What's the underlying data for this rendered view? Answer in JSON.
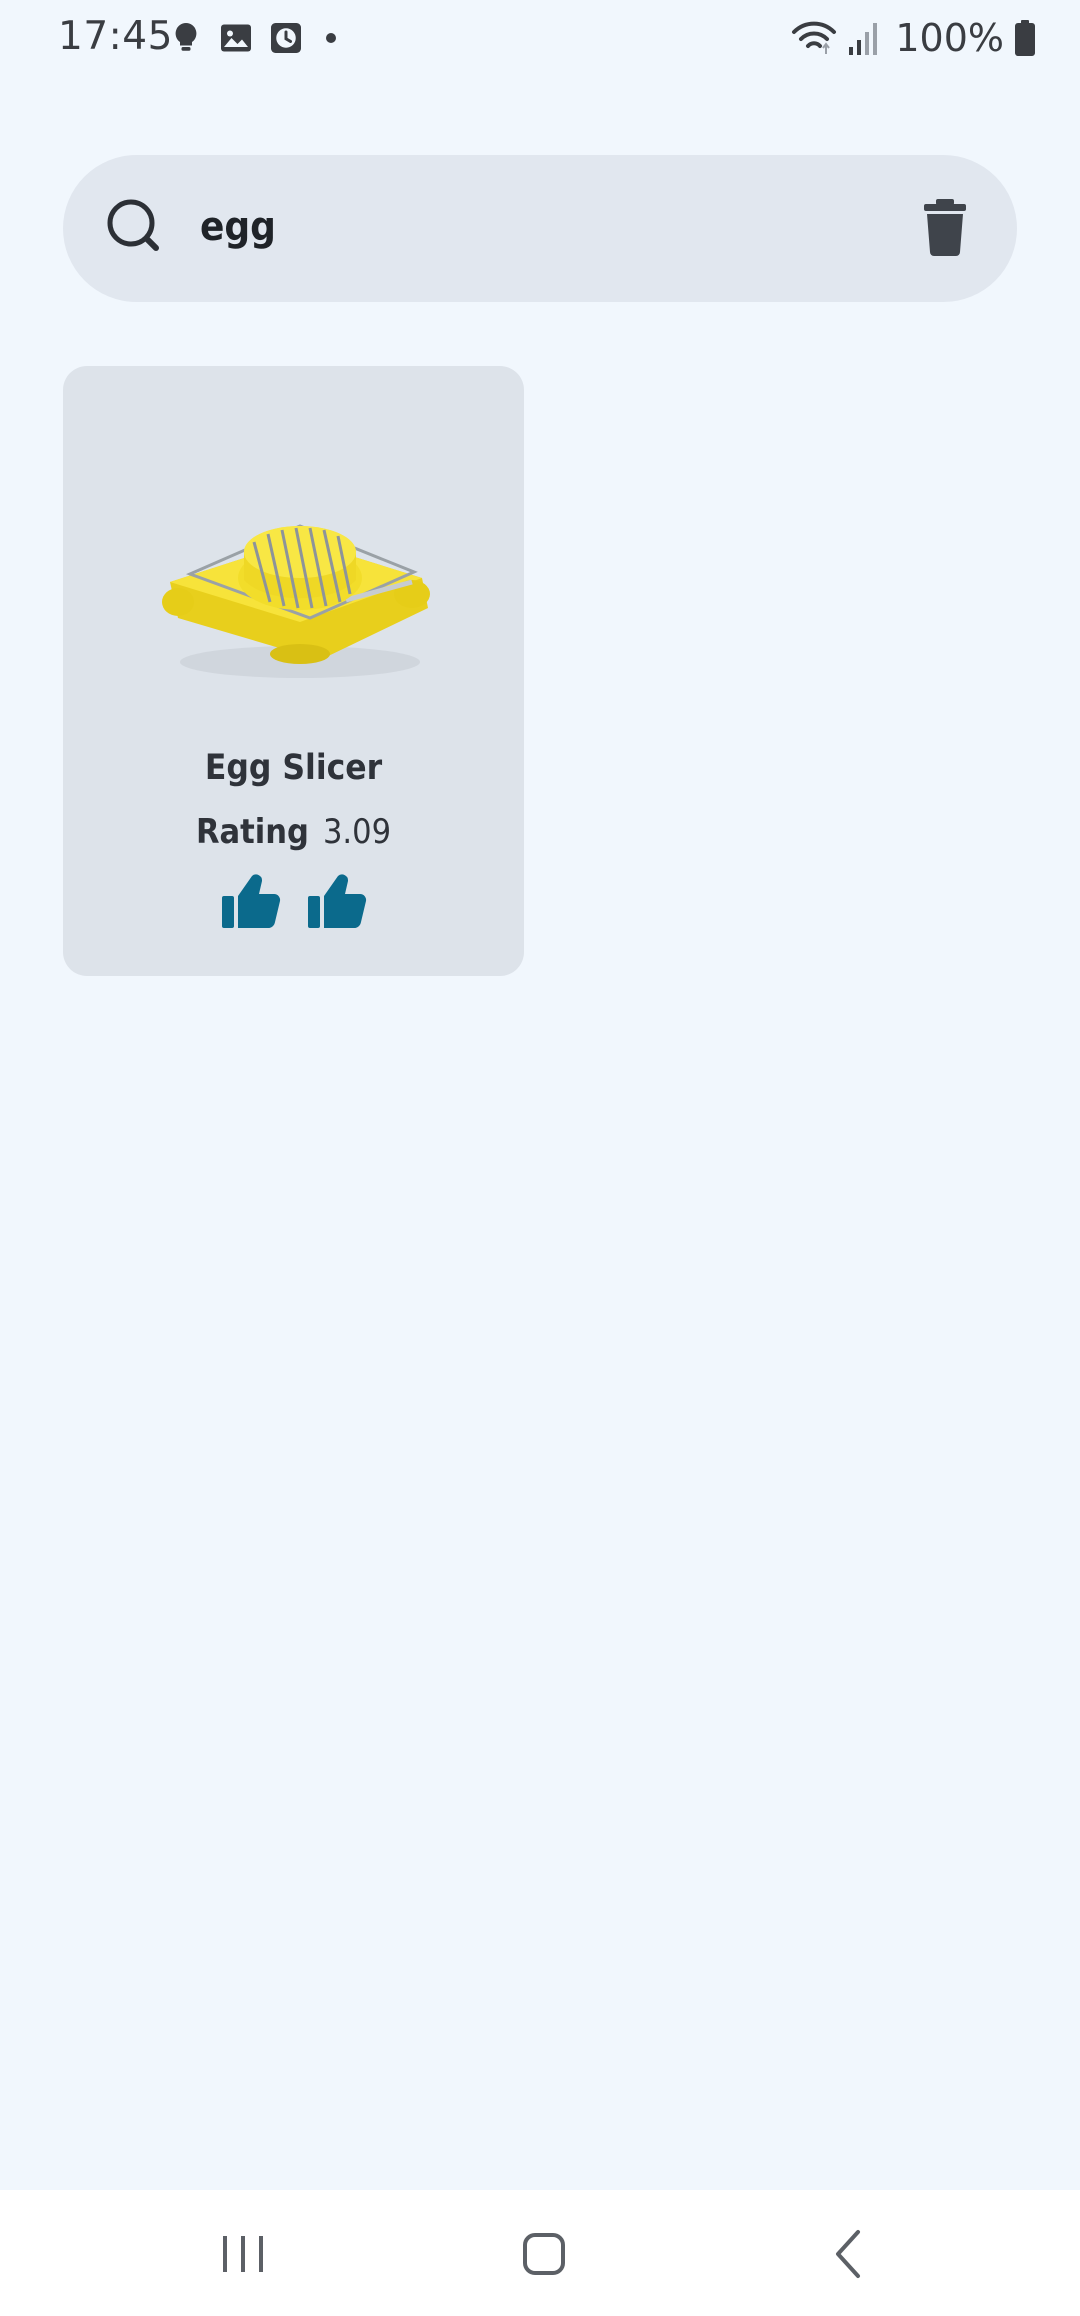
{
  "status_bar": {
    "time": "17:45",
    "battery": "100%",
    "left_icons": [
      "bulb-icon",
      "image-icon",
      "clock-icon",
      "dot-icon"
    ],
    "right_icons": [
      "wifi-icon",
      "signal-icon",
      "battery-icon"
    ]
  },
  "search": {
    "value": "egg",
    "icon": "search-icon",
    "clear_icon": "trash-icon"
  },
  "results": [
    {
      "name": "Egg Slicer",
      "rating_label": "Rating",
      "rating_value": "3.09",
      "thumbs": [
        "thumbs-up-icon",
        "thumbs-up-icon"
      ],
      "thumb_color": "#0b6a8c"
    }
  ],
  "nav_bar": {
    "buttons": [
      "recents-icon",
      "home-icon",
      "back-icon"
    ]
  },
  "colors": {
    "background": "#f1f7fd",
    "search_bar": "#e1e7ef",
    "card": "#dde3ea",
    "accent": "#0b6a8c",
    "product_yellow": "#f3df2e"
  }
}
